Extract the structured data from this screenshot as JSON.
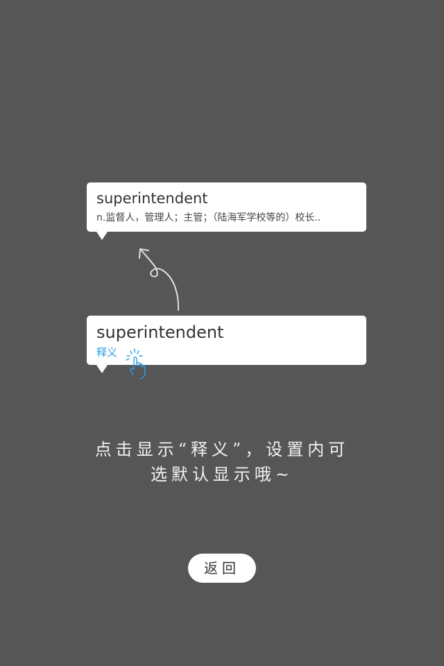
{
  "popup_expanded": {
    "word": "superintendent",
    "definition": "n.监督人，管理人；主管；（陆海军学校等的）校长.."
  },
  "popup_collapsed": {
    "word": "superintendent",
    "meaning_link": "释义"
  },
  "hint": {
    "line1": "点击显示“释义”，设置内可",
    "line2": "选默认显示哦~"
  },
  "back_button": {
    "label": "返回"
  },
  "colors": {
    "background": "#565656",
    "card": "#ffffff",
    "accent": "#2e9fe6"
  },
  "icons": {
    "curved_arrow": "curved-arrow-icon",
    "tap_hand": "tap-hand-icon"
  }
}
